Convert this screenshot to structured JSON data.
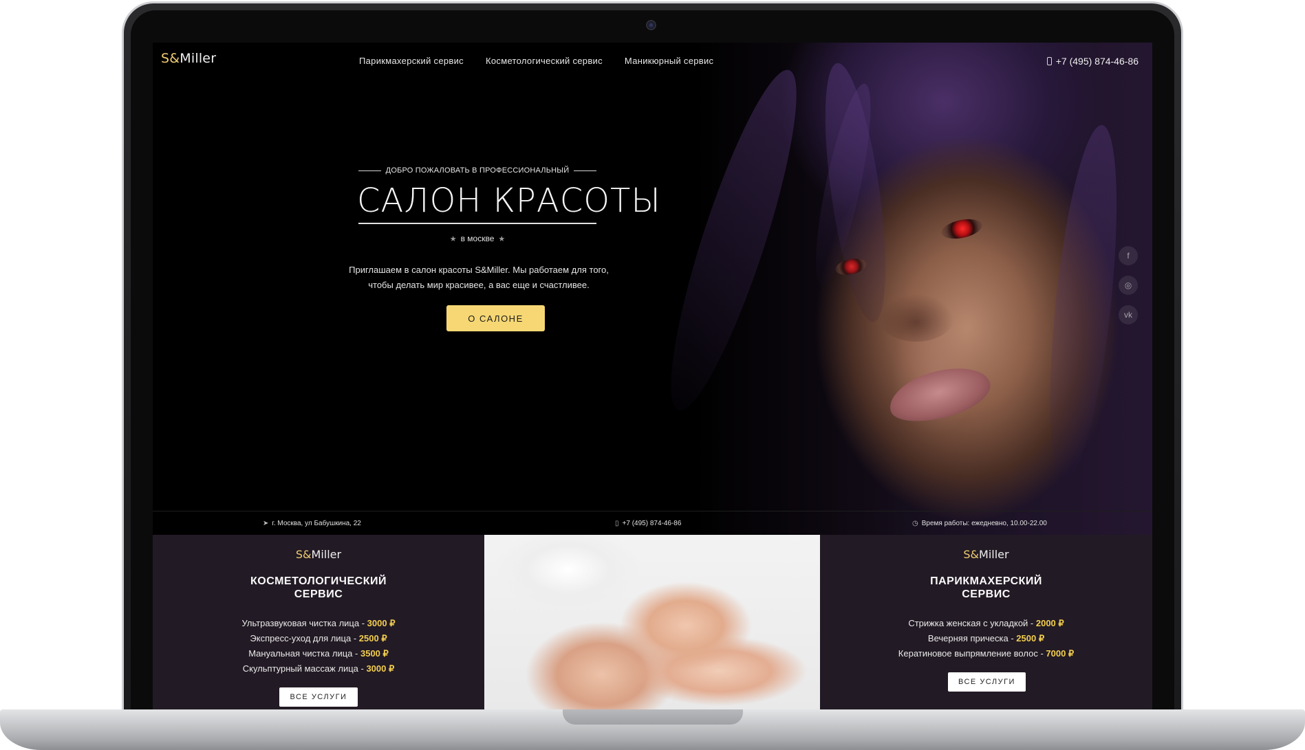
{
  "header": {
    "logo_accent": "S&",
    "logo_rest": "Miller",
    "nav": [
      {
        "label": "Парикмахерский сервис"
      },
      {
        "label": "Косметологический сервис"
      },
      {
        "label": "Маникюрный сервис"
      }
    ],
    "phone": "+7 (495) 874-46-86"
  },
  "hero": {
    "welcome": "ДОБРО ПОЖАЛОВАТЬ В ПРОФЕССИОНАЛЬНЫЙ",
    "title": "САЛОН КРАСОТЫ",
    "city": "в москве",
    "intro_line1": "Приглашаем в салон красоты S&Miller. Мы работаем для того,",
    "intro_line2": "чтобы делать мир красивее, а вас еще и счастливее.",
    "button": "О САЛОНЕ"
  },
  "socials": [
    {
      "icon": "facebook-icon",
      "glyph": "f"
    },
    {
      "icon": "instagram-icon",
      "glyph": "◎"
    },
    {
      "icon": "vk-icon",
      "glyph": "vk"
    }
  ],
  "info": {
    "address": "г. Москва, ул Бабушкина, 22",
    "phone": "+7 (495) 874-46-86",
    "hours": "Время работы: ежедневно, 10.00-22.00"
  },
  "cards": {
    "cosmetology": {
      "logo_accent": "S&",
      "logo_rest": "Miller",
      "title_line1": "КОСМЕТОЛОГИЧЕСКИЙ",
      "title_line2": "СЕРВИС",
      "items": [
        {
          "name": "Ультразвуковая чистка лица - ",
          "price": "3000 ₽"
        },
        {
          "name": "Экспресс-уход для лица - ",
          "price": "2500 ₽"
        },
        {
          "name": "Мануальная чистка лица - ",
          "price": "3500 ₽"
        },
        {
          "name": "Скульптурный массаж лица - ",
          "price": "3000 ₽"
        }
      ],
      "button": "ВСЕ УСЛУГИ"
    },
    "hairdressing": {
      "logo_accent": "S&",
      "logo_rest": "Miller",
      "title_line1": "ПАРИКМАХЕРСКИЙ",
      "title_line2": "СЕРВИС",
      "items": [
        {
          "name": "Стрижка женская с укладкой - ",
          "price": "2000 ₽"
        },
        {
          "name": "Вечерняя прическа - ",
          "price": "2500 ₽"
        },
        {
          "name": "Кератиновое выпрямление волос - ",
          "price": "7000 ₽"
        }
      ],
      "button": "ВСЕ УСЛУГИ"
    }
  },
  "colors": {
    "accent": "#f6d774",
    "card_bg": "#221a24",
    "price": "#f3cf4f"
  }
}
